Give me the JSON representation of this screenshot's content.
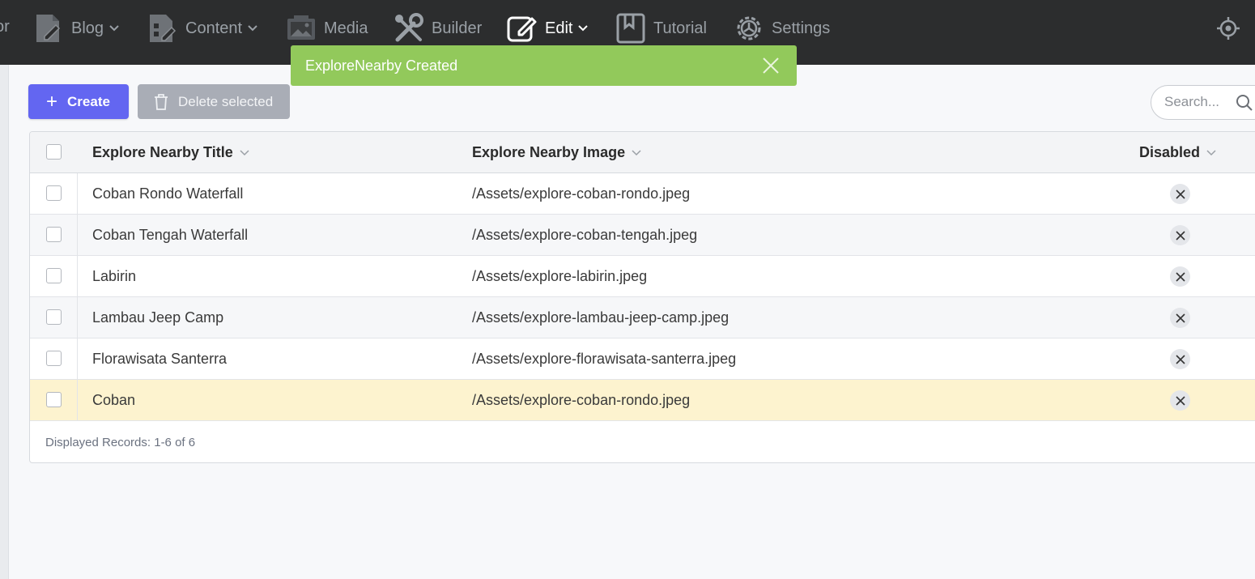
{
  "nav": {
    "fragment": "or",
    "items": [
      {
        "label": "Blog",
        "icon": "blog-icon",
        "chevron": true
      },
      {
        "label": "Content",
        "icon": "content-icon",
        "chevron": true
      },
      {
        "label": "Media",
        "icon": "media-icon",
        "chevron": false
      },
      {
        "label": "Builder",
        "icon": "builder-icon",
        "chevron": false
      },
      {
        "label": "Edit",
        "icon": "edit-icon",
        "chevron": true
      },
      {
        "label": "Tutorial",
        "icon": "tutorial-icon",
        "chevron": false
      },
      {
        "label": "Settings",
        "icon": "settings-icon",
        "chevron": false
      }
    ],
    "active": "Edit"
  },
  "toast": {
    "message": "ExploreNearby Created",
    "color": "#92c95b"
  },
  "toolbar": {
    "create_label": "Create",
    "delete_label": "Delete selected",
    "search_placeholder": "Search..."
  },
  "grid": {
    "columns": [
      "Explore Nearby Title",
      "Explore Nearby Image",
      "Disabled"
    ],
    "rows": [
      {
        "title": "Coban Rondo Waterfall",
        "image": "/Assets/explore-coban-rondo.jpeg"
      },
      {
        "title": "Coban Tengah Waterfall",
        "image": "/Assets/explore-coban-tengah.jpeg"
      },
      {
        "title": "Labirin",
        "image": "/Assets/explore-labirin.jpeg"
      },
      {
        "title": "Lambau Jeep Camp",
        "image": "/Assets/explore-lambau-jeep-camp.jpeg"
      },
      {
        "title": "Florawisata Santerra",
        "image": "/Assets/explore-florawisata-santerra.jpeg"
      },
      {
        "title": "Coban",
        "image": "/Assets/explore-coban-rondo.jpeg"
      }
    ],
    "footer": "Displayed Records: 1-6 of 6"
  },
  "colors": {
    "accent": "#6366f1",
    "nav_bg": "#2c2d2e",
    "highlight_row": "#fdf3cf"
  }
}
